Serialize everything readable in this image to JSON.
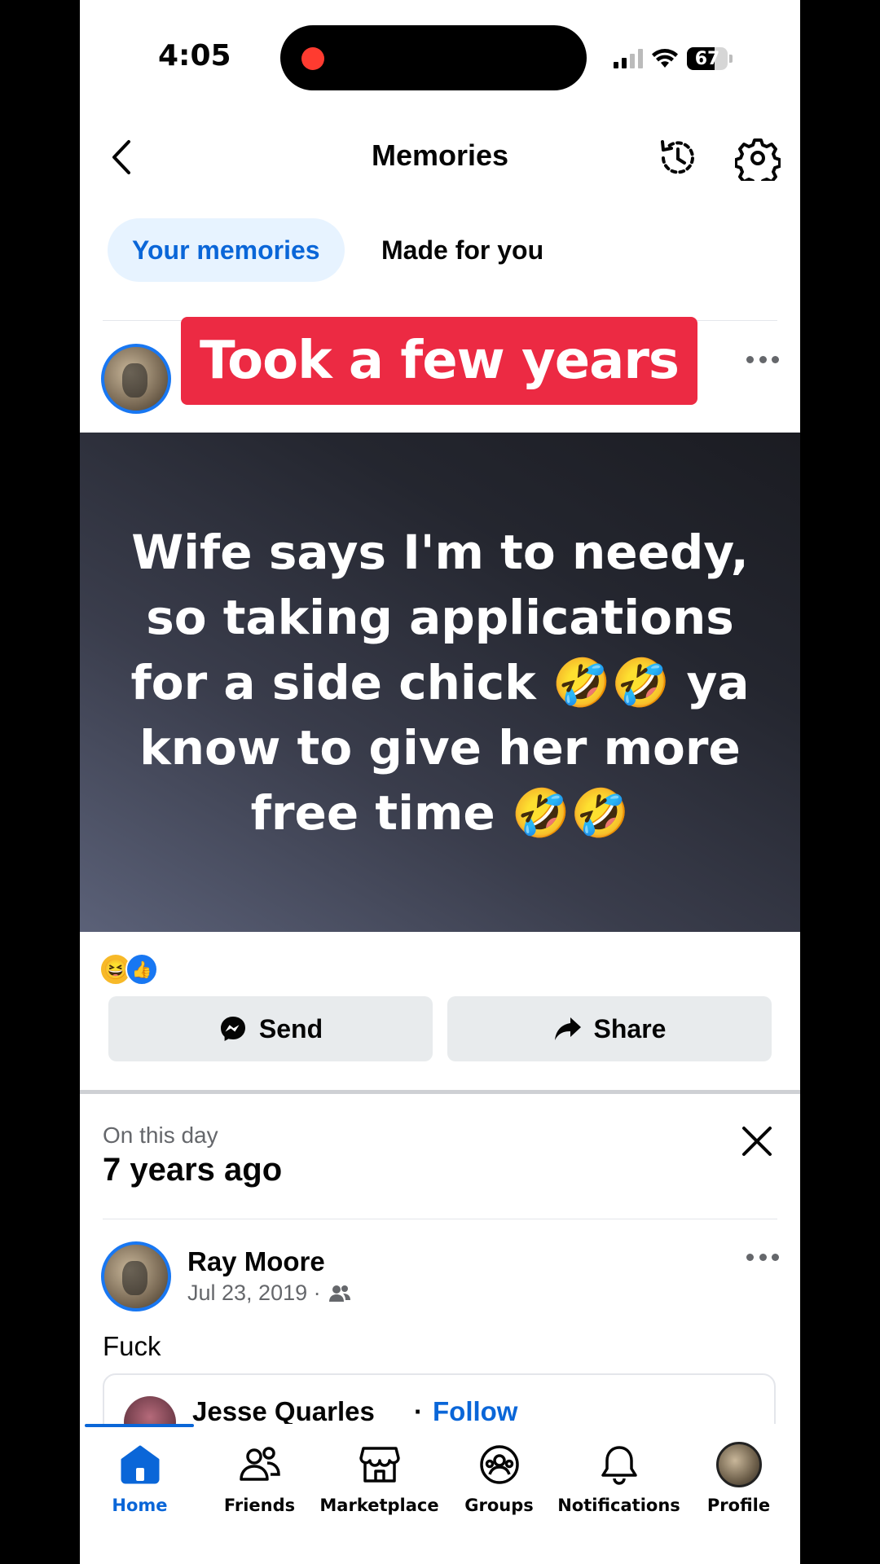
{
  "status_bar": {
    "time": "4:05",
    "battery": "67",
    "battery_level": 0.67
  },
  "header": {
    "title": "Memories"
  },
  "tabs": [
    {
      "label": "Your memories",
      "active": true
    },
    {
      "label": "Made for you",
      "active": false
    }
  ],
  "overlay_caption": "Took a few years",
  "post_text": "Wife says I'm to needy, so taking applications for a side chick 🤣🤣 ya know to give her more free time 🤣🤣",
  "reactions": [
    "haha",
    "like"
  ],
  "actions": {
    "send": "Send",
    "share": "Share"
  },
  "on_this_day": {
    "label": "On this day",
    "title": "7 years ago"
  },
  "memory_post": {
    "author": "Ray Moore",
    "date": "Jul 23, 2019 ·",
    "text": "Fuck",
    "shared": {
      "name": "Jesse Quarles",
      "separator": "·",
      "follow": "Follow"
    }
  },
  "bottom_nav": [
    {
      "label": "Home",
      "icon": "home-icon",
      "active": true
    },
    {
      "label": "Friends",
      "icon": "friends-icon",
      "active": false
    },
    {
      "label": "Marketplace",
      "icon": "marketplace-icon",
      "active": false
    },
    {
      "label": "Groups",
      "icon": "groups-icon",
      "active": false
    },
    {
      "label": "Notifications",
      "icon": "bell-icon",
      "active": false
    },
    {
      "label": "Profile",
      "icon": "profile-avatar",
      "active": false
    }
  ],
  "colors": {
    "accent": "#0a66d8",
    "caption_red": "#ec2a43",
    "tab_bg": "#e7f3ff"
  }
}
